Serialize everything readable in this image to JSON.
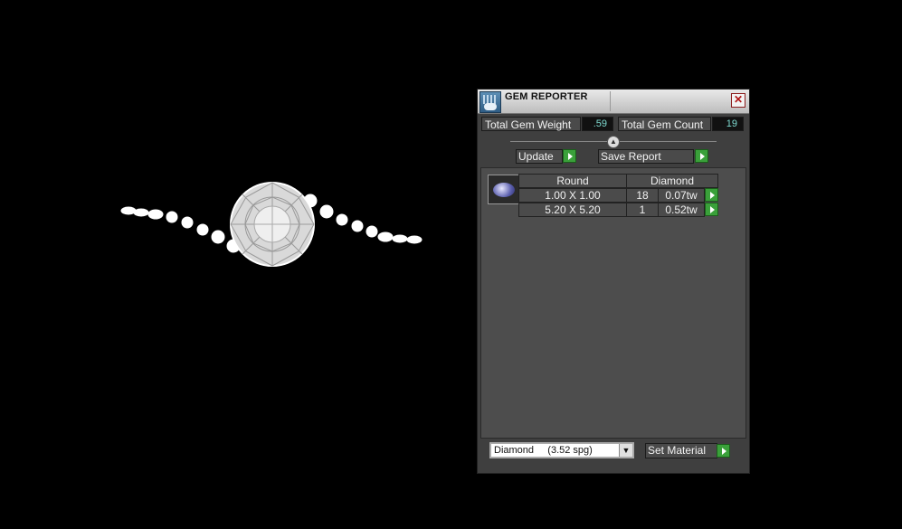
{
  "panel": {
    "title": "GEM REPORTER",
    "close_glyph": "✕",
    "total_weight_label": "Total Gem Weight",
    "total_weight_value": ".59",
    "total_count_label": "Total Gem Count",
    "total_count_value": "19",
    "update_label": "Update",
    "save_report_label": "Save Report",
    "table": {
      "headers": [
        "Round",
        "Diamond"
      ],
      "rows": [
        {
          "size": "1.00 X 1.00",
          "count": "18",
          "weight": "0.07tw"
        },
        {
          "size": "5.20 X 5.20",
          "count": "1",
          "weight": "0.52tw"
        }
      ]
    },
    "material_value": "Diamond     (3.52 spg)",
    "set_material_label": "Set Material"
  },
  "colors": {
    "play_button": "#3aa03a",
    "value_text": "#7fdcd2"
  },
  "icons": [
    "gem-reporter-icon",
    "close-icon",
    "slider-knob-icon",
    "play-icon",
    "gem-thumbnail-icon",
    "chevron-down-icon"
  ]
}
